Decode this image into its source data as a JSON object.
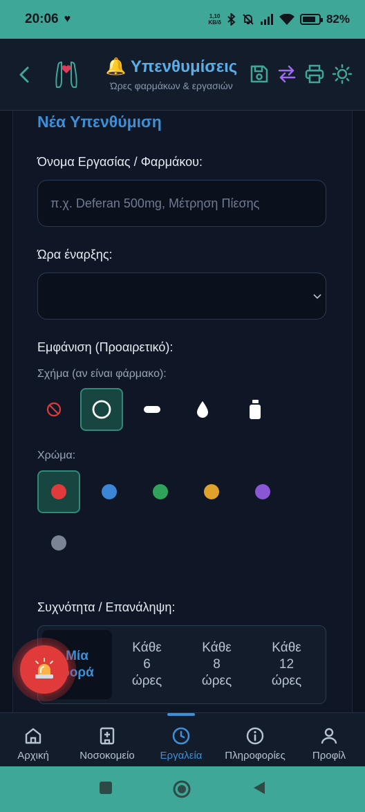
{
  "status": {
    "time": "20:06",
    "net_speed_top": "1,10",
    "net_speed_bottom": "KB/δ",
    "battery": "82%",
    "battery_level": 0.82
  },
  "header": {
    "bell": "🔔",
    "title": "Υπενθυμίσεις",
    "subtitle": "Ώρες φαρμάκων & εργασιών"
  },
  "form": {
    "section_title": "Νέα Υπενθύμιση",
    "name_label": "Όνομα Εργασίας / Φαρμάκου:",
    "name_placeholder": "π.χ. Deferan 500mg, Μέτρηση Πίεσης",
    "name_value": "",
    "time_label": "Ώρα έναρξης:",
    "time_value": "",
    "appearance_label": "Εμφάνιση (Προαιρετικό):",
    "shape_label": "Σχήμα (αν είναι φάρμακο):",
    "shapes": [
      {
        "icon": "none-icon",
        "selected": false
      },
      {
        "icon": "circle-pill-icon",
        "selected": true
      },
      {
        "icon": "oval-pill-icon",
        "selected": false
      },
      {
        "icon": "drop-icon",
        "selected": false
      },
      {
        "icon": "bottle-icon",
        "selected": false
      }
    ],
    "color_label": "Χρώμα:",
    "colors": [
      {
        "hex": "#e03a3a",
        "selected": true
      },
      {
        "hex": "#3b86d6",
        "selected": false
      },
      {
        "hex": "#2fa35c",
        "selected": false
      },
      {
        "hex": "#e0a22b",
        "selected": false
      },
      {
        "hex": "#8a56d6",
        "selected": false
      },
      {
        "hex": "#7b8494",
        "selected": false
      }
    ],
    "frequency_label": "Συχνότητα / Επανάληψη:",
    "frequency_options": [
      {
        "label": "Μία\nφορά",
        "active": true
      },
      {
        "label": "Κάθε\n6\nώρες",
        "active": false
      },
      {
        "label": "Κάθε\n8\nώρες",
        "active": false
      },
      {
        "label": "Κάθε\n12\nώρες",
        "active": false
      }
    ]
  },
  "nav": {
    "items": [
      {
        "label": "Αρχική",
        "icon": "home-icon",
        "active": false
      },
      {
        "label": "Νοσοκομείο",
        "icon": "hospital-icon",
        "active": false
      },
      {
        "label": "Εργαλεία",
        "icon": "clock-icon",
        "active": true
      },
      {
        "label": "Πληροφορίες",
        "icon": "info-icon",
        "active": false
      },
      {
        "label": "Προφίλ",
        "icon": "profile-icon",
        "active": false
      }
    ]
  },
  "colors": {
    "status_bar": "#3fa797",
    "accent": "#3d8fd6",
    "background": "#0d1420",
    "selected_bg": "#16463f"
  }
}
